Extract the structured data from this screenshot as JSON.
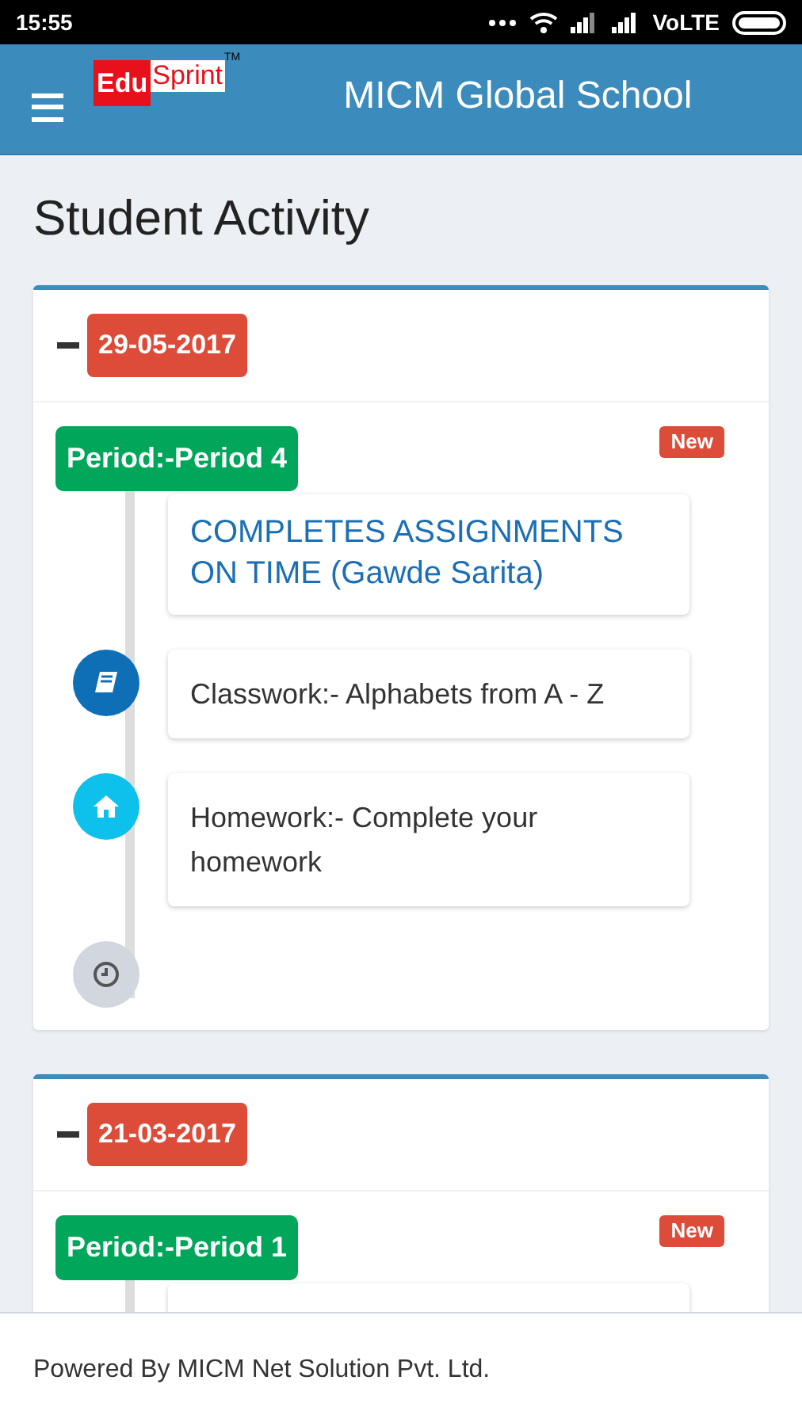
{
  "status_bar": {
    "time": "15:55",
    "network": "VoLTE"
  },
  "header": {
    "logo": {
      "part_1": "Edu",
      "part_2": "Sprint",
      "mark": "TM"
    },
    "title": "MICM Global School"
  },
  "page_title": "Student Activity",
  "days": [
    {
      "date": "29-05-2017",
      "expanded": true,
      "periods": [
        {
          "label": "Period:-Period 4",
          "badge": "New",
          "entries": [
            {
              "kind": "remark",
              "text": "COMPLETES ASSIGNMENTS ON TIME (Gawde Sarita)"
            },
            {
              "kind": "classwork",
              "text": "Classwork:- Alphabets from A - Z"
            },
            {
              "kind": "homework",
              "text": "Homework:- Complete your homework"
            },
            {
              "kind": "end"
            }
          ]
        }
      ]
    },
    {
      "date": "21-03-2017",
      "expanded": true,
      "periods": [
        {
          "label": "Period:-Period 1",
          "badge": "New",
          "entries": [
            {
              "kind": "remark"
            }
          ]
        }
      ]
    }
  ],
  "footer": "Powered By MICM Net Solution Pvt. Ltd."
}
